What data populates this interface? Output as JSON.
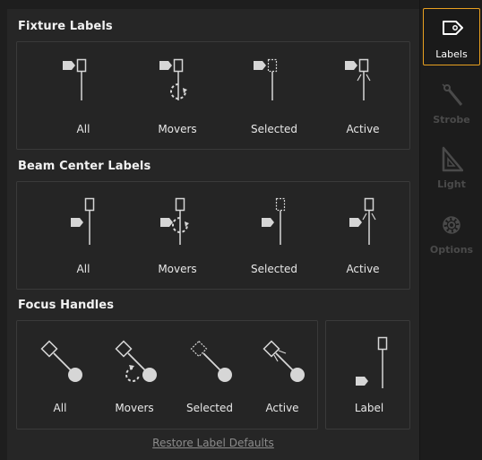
{
  "sections": {
    "fixture_labels": {
      "title": "Fixture Labels",
      "options": [
        "All",
        "Movers",
        "Selected",
        "Active"
      ]
    },
    "beam_center_labels": {
      "title": "Beam Center Labels",
      "options": [
        "All",
        "Movers",
        "Selected",
        "Active"
      ]
    },
    "focus_handles": {
      "title": "Focus Handles",
      "options": [
        "All",
        "Movers",
        "Selected",
        "Active"
      ],
      "label_option": "Label"
    }
  },
  "restore_link": "Restore Label Defaults",
  "sidebar": {
    "tabs": [
      {
        "label": "Labels",
        "icon": "tag-icon",
        "active": true
      },
      {
        "label": "Strobe",
        "icon": "wand-icon",
        "active": false
      },
      {
        "label": "Light",
        "icon": "triangle-ruler-icon",
        "active": false
      },
      {
        "label": "Options",
        "icon": "gear-icon",
        "active": false
      }
    ]
  },
  "colors": {
    "accent": "#e8a020",
    "icon": "#d6d6d6",
    "background": "#262626"
  }
}
